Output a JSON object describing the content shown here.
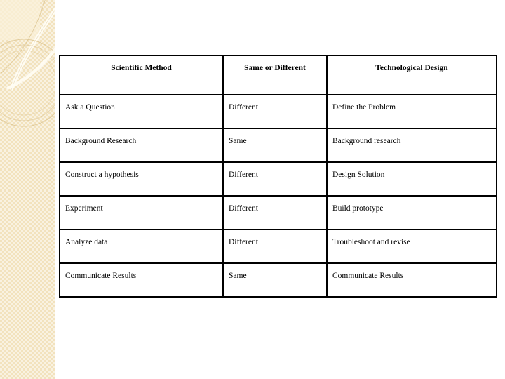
{
  "slide": {
    "background_color": "#ffffff",
    "sidebar": {
      "name": "decorative-sidebar-band",
      "base_color": "#f2e2bd",
      "highlight_color": "#faf0d8",
      "arc_light_color": "#fffdf4",
      "arc_outline_color": "#d9c08a"
    }
  },
  "table": {
    "border_color": "#000000",
    "columns": [
      {
        "key": "scientific_method",
        "header": "Scientific Method"
      },
      {
        "key": "same_or_different",
        "header": "Same or Different"
      },
      {
        "key": "technological_design",
        "header": "Technological Design"
      }
    ],
    "rows": [
      {
        "scientific_method": "Ask a Question",
        "same_or_different": "Different",
        "technological_design": "Define the Problem"
      },
      {
        "scientific_method": "Background Research",
        "same_or_different": "Same",
        "technological_design": "Background research"
      },
      {
        "scientific_method": "Construct a hypothesis",
        "same_or_different": "Different",
        "technological_design": "Design Solution"
      },
      {
        "scientific_method": "Experiment",
        "same_or_different": "Different",
        "technological_design": "Build prototype"
      },
      {
        "scientific_method": "Analyze data",
        "same_or_different": "Different",
        "technological_design": "Troubleshoot and revise"
      },
      {
        "scientific_method": "Communicate Results",
        "same_or_different": "Same",
        "technological_design": "Communicate Results"
      }
    ]
  }
}
